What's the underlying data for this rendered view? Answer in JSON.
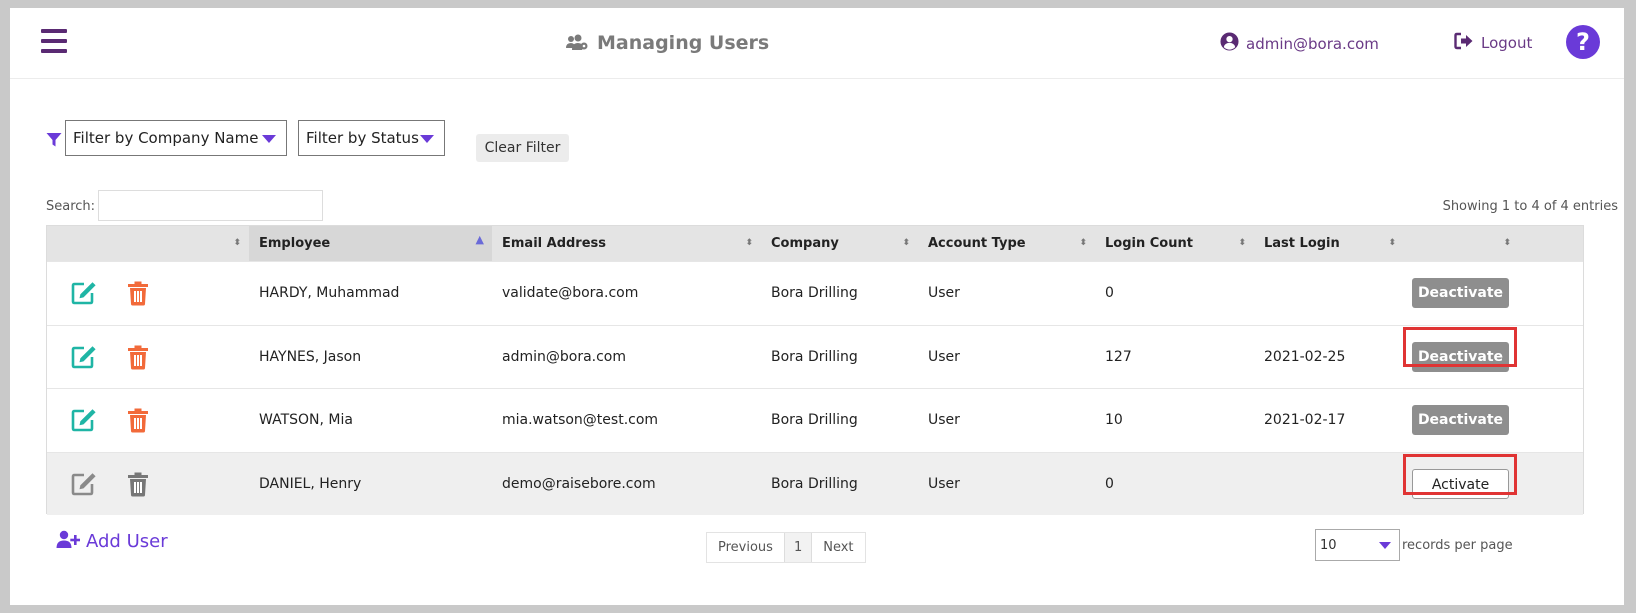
{
  "header": {
    "title": "Managing Users",
    "user_email": "admin@bora.com",
    "logout_label": "Logout",
    "help_label": "?"
  },
  "filters": {
    "company_placeholder": "Filter by Company Name",
    "status_placeholder": "Filter by Status",
    "clear_label": "Clear Filter"
  },
  "search": {
    "label": "Search:",
    "value": ""
  },
  "showing_text": "Showing 1 to 4 of 4 entries",
  "table": {
    "columns": [
      "",
      "Employee",
      "Email Address",
      "Company",
      "Account Type",
      "Login Count",
      "Last Login",
      ""
    ],
    "rows": [
      {
        "employee": "HARDY, Muhammad",
        "email": "validate@bora.com",
        "company": "Bora Drilling",
        "account_type": "User",
        "login_count": "0",
        "last_login": "",
        "action": "Deactivate",
        "active": true
      },
      {
        "employee": "HAYNES, Jason",
        "email": "admin@bora.com",
        "company": "Bora Drilling",
        "account_type": "User",
        "login_count": "127",
        "last_login": "2021-02-25",
        "action": "Deactivate",
        "active": true
      },
      {
        "employee": "WATSON, Mia",
        "email": "mia.watson@test.com",
        "company": "Bora Drilling",
        "account_type": "User",
        "login_count": "10",
        "last_login": "2021-02-17",
        "action": "Deactivate",
        "active": true
      },
      {
        "employee": "DANIEL, Henry",
        "email": "demo@raisebore.com",
        "company": "Bora Drilling",
        "account_type": "User",
        "login_count": "0",
        "last_login": "",
        "action": "Activate",
        "active": false
      }
    ]
  },
  "footer": {
    "add_user_label": "Add User",
    "pager": {
      "previous": "Previous",
      "current": "1",
      "next": "Next"
    },
    "records_per_page_value": "10",
    "records_per_page_label": "records per page"
  },
  "colors": {
    "accent_purple": "#6a3ad8",
    "brand_dark_purple": "#5a2a73",
    "edit_teal": "#1fb5a5",
    "delete_orange": "#f26a3a",
    "highlight_red": "#e03434",
    "deactivate_gray": "#8e8e8e"
  },
  "icons": [
    "menu-icon",
    "users-cog-icon",
    "user-circle-icon",
    "logout-icon",
    "help-icon",
    "filter-icon",
    "sort-icon",
    "edit-icon",
    "trash-icon",
    "user-plus-icon",
    "chevron-down-icon"
  ]
}
